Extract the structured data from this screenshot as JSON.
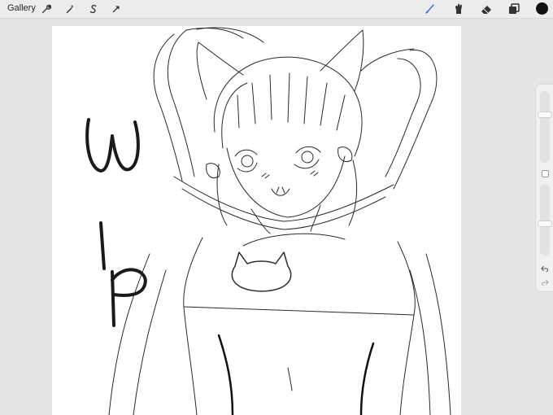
{
  "app": {
    "gallery_label": "Gallery"
  },
  "toolbar": {
    "left_icons": [
      "wrench-icon",
      "magic-wand-icon",
      "selection-s-icon",
      "transform-arrow-icon"
    ],
    "right_icons": [
      "brush-icon",
      "smudge-icon",
      "eraser-icon",
      "layers-icon"
    ],
    "active_tool": "brush",
    "accent_color": "#2b6cf6",
    "current_color": "#111111"
  },
  "canvas": {
    "text": "WIP"
  },
  "sidebar": {
    "brush_size_level": 0.7,
    "opacity_level": 0.45,
    "icons": [
      "square-modify-icon",
      "undo-icon",
      "redo-icon"
    ]
  }
}
